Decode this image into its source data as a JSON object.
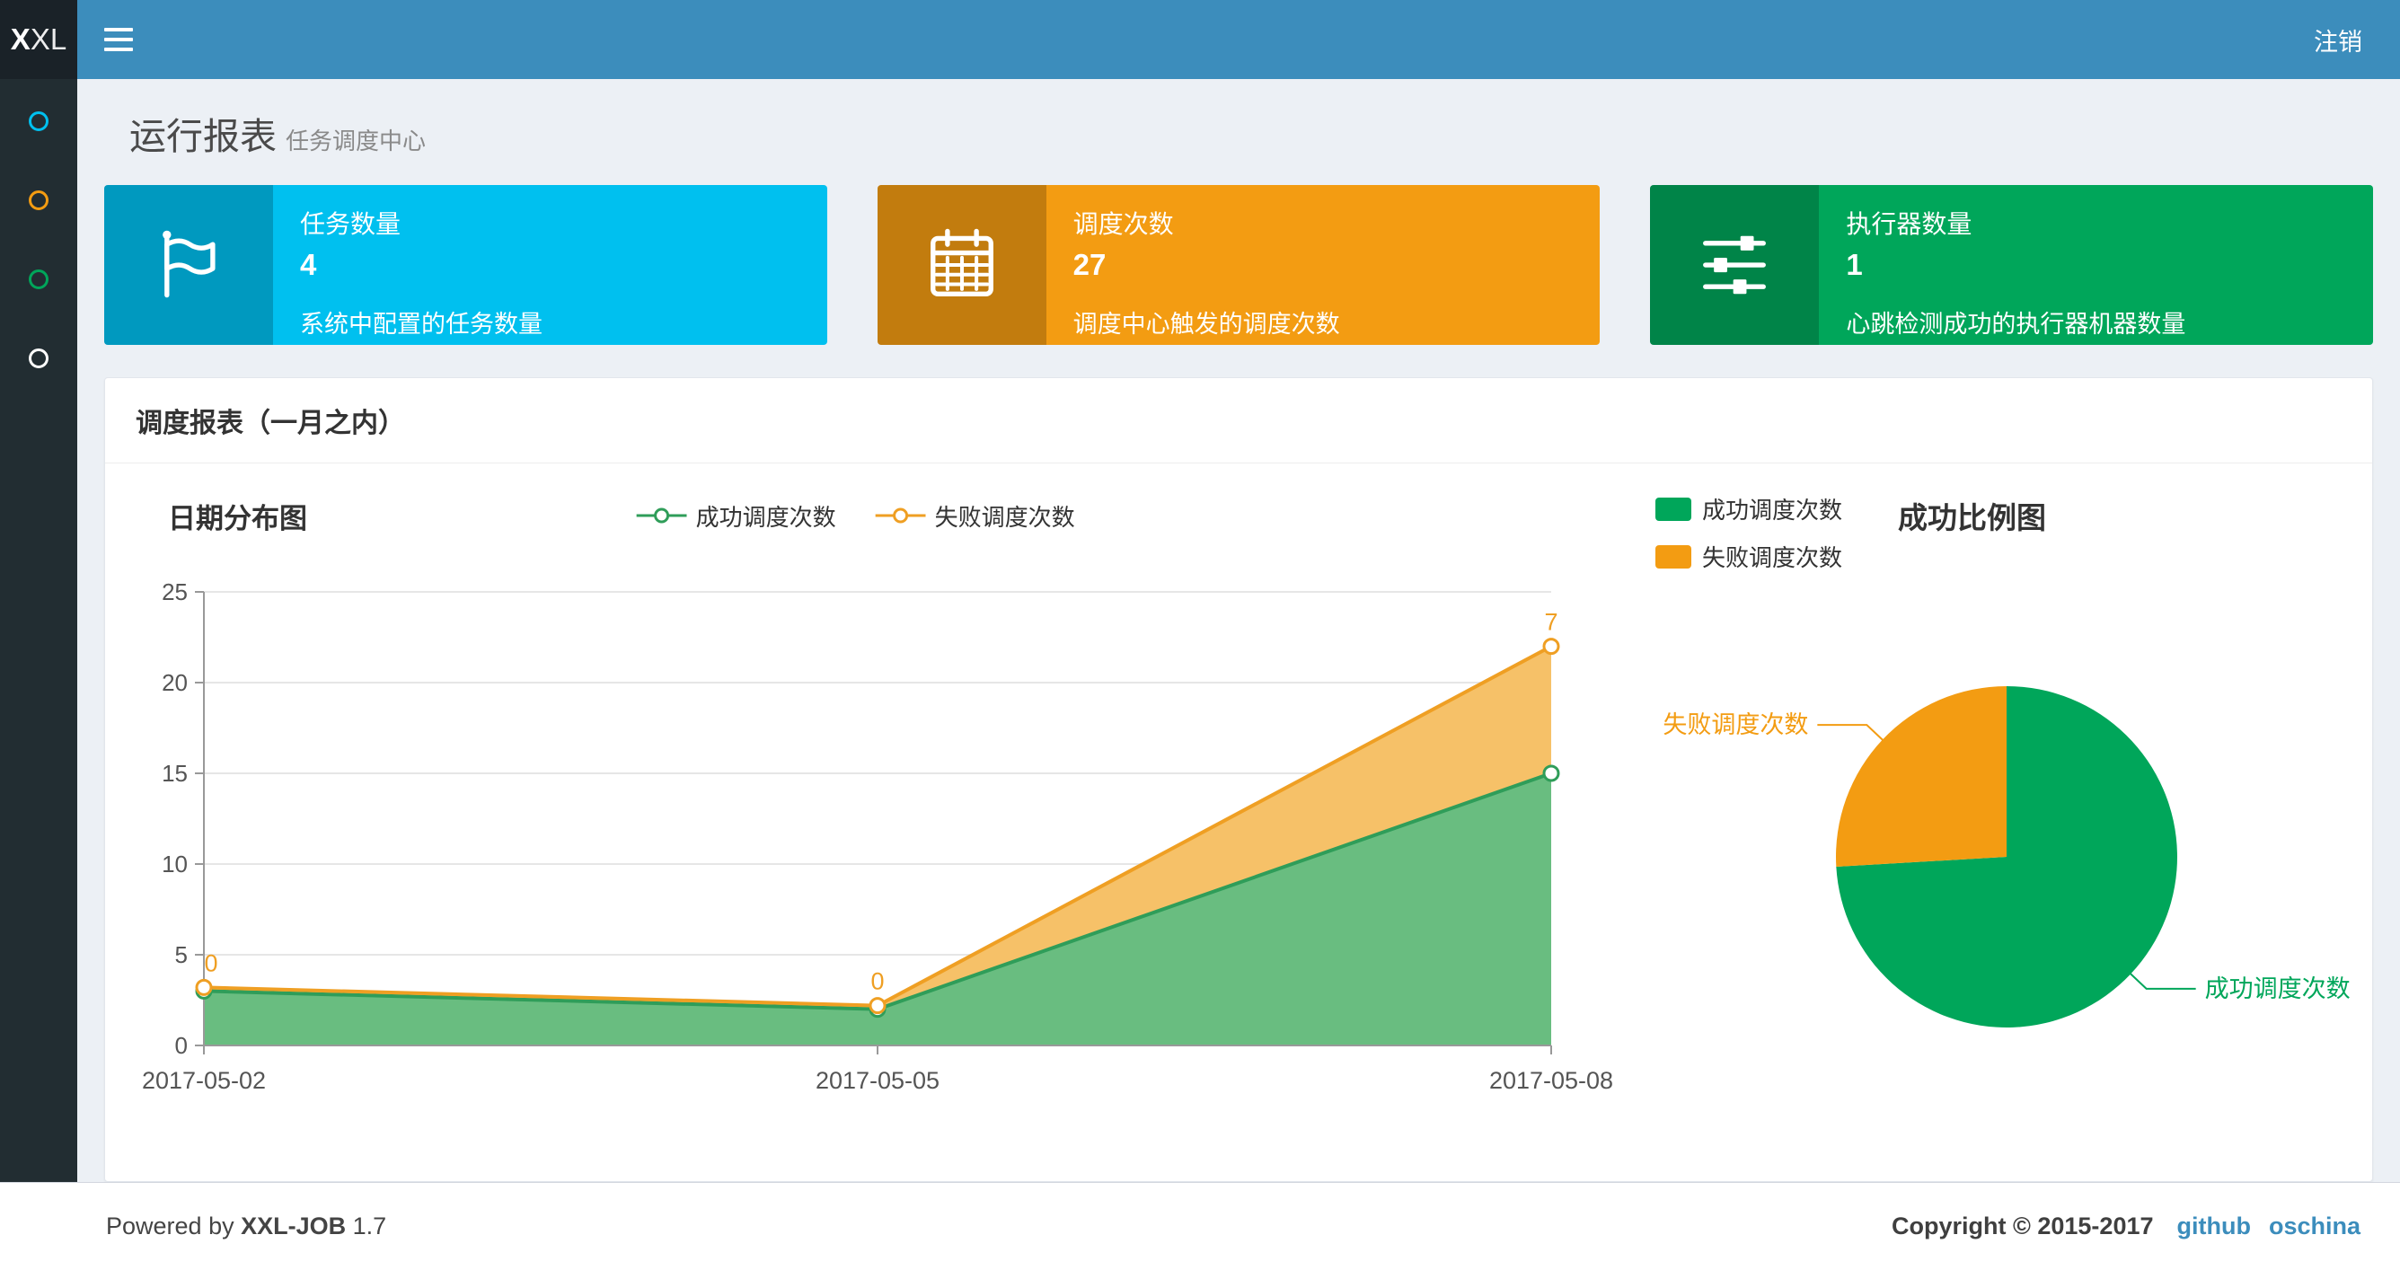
{
  "colors": {
    "navbar": "#3c8dbc",
    "logo_bg": "#1a2228",
    "sidebar": "#222d32",
    "content_bg": "#ecf0f5",
    "link": "#3c8dbc"
  },
  "header": {
    "logo_bold": "X",
    "logo_rest": "XL",
    "logout": "注销"
  },
  "sidebar": {
    "items": [
      {
        "icon": "circle-icon",
        "color": "#00c0ef"
      },
      {
        "icon": "circle-icon",
        "color": "#f39c12"
      },
      {
        "icon": "circle-icon",
        "color": "#00a65a"
      },
      {
        "icon": "circle-icon",
        "color": "#ffffff"
      }
    ]
  },
  "page_header": {
    "title": "运行报表",
    "subtitle": "任务调度中心"
  },
  "info_boxes": [
    {
      "icon": "flag-icon",
      "bg": "#00c0ef",
      "label": "任务数量",
      "value": "4",
      "desc": "系统中配置的任务数量"
    },
    {
      "icon": "calendar-icon",
      "bg": "#f39c12",
      "label": "调度次数",
      "value": "27",
      "desc": "调度中心触发的调度次数"
    },
    {
      "icon": "sliders-icon",
      "bg": "#00a65a",
      "label": "执行器数量",
      "value": "1",
      "desc": "心跳检测成功的执行器机器数量"
    }
  ],
  "panel": {
    "title": "调度报表（一月之内）"
  },
  "chart_data": [
    {
      "type": "area",
      "title": "日期分布图",
      "stacked": true,
      "grid": true,
      "legend_position": "top-center",
      "categories": [
        "2017-05-02",
        "2017-05-05",
        "2017-05-08"
      ],
      "ylim": [
        0,
        25
      ],
      "ytick_interval": 5,
      "series": [
        {
          "name": "成功调度次数",
          "color": "#2f9d59",
          "area_color": "#69bd80",
          "values": [
            3,
            2,
            15
          ]
        },
        {
          "name": "失败调度次数",
          "color": "#ef9f23",
          "area_color": "#f6c168",
          "values": [
            0,
            0,
            7
          ],
          "point_labels": [
            "0",
            "0",
            "7"
          ]
        }
      ]
    },
    {
      "type": "pie",
      "title": "成功比例图",
      "legend_position": "top-left",
      "series": [
        {
          "name": "成功调度次数",
          "value": 20,
          "color": "#00a65a"
        },
        {
          "name": "失败调度次数",
          "value": 7,
          "color": "#f39c12"
        }
      ]
    }
  ],
  "footer": {
    "powered_prefix": "Powered by",
    "brand": "XXL-JOB",
    "version": "1.7",
    "copyright": "Copyright © 2015-2017",
    "links": [
      "github",
      "oschina"
    ]
  }
}
